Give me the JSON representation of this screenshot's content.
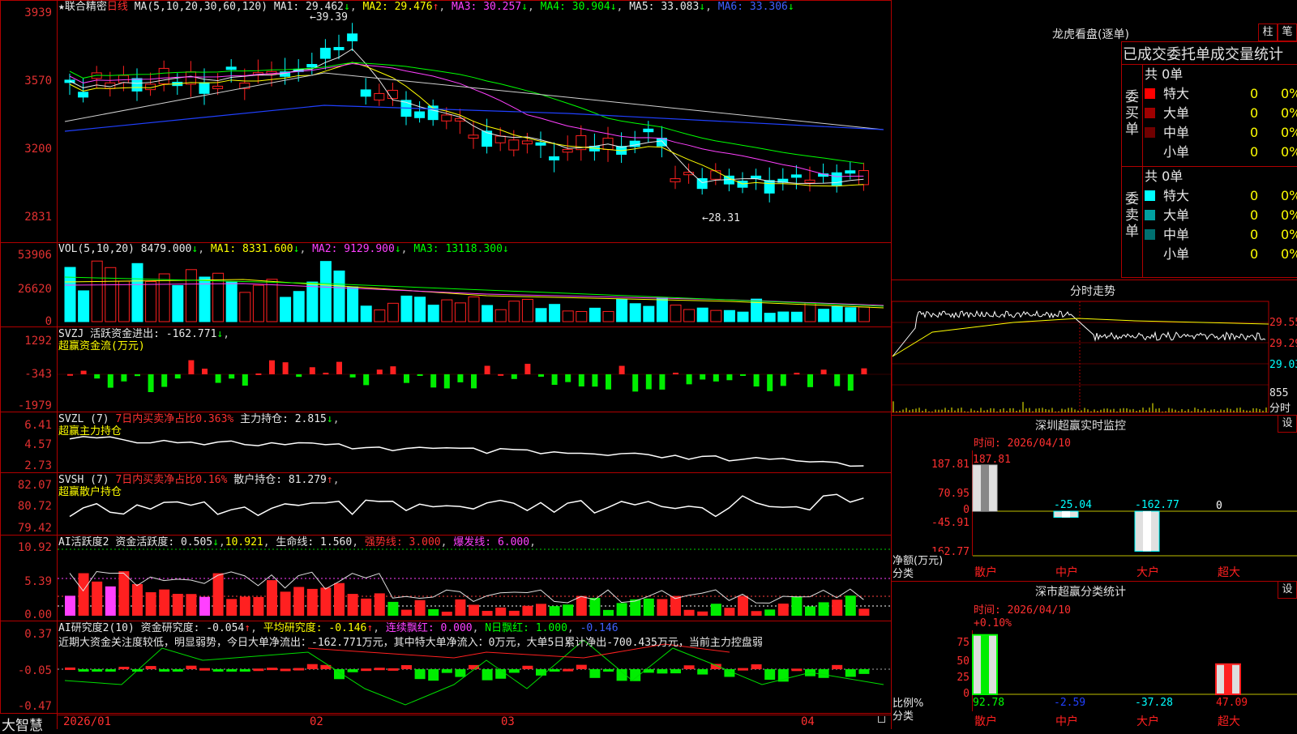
{
  "stock": {
    "name": "联合精密",
    "period": "日线",
    "ma_header": "MA(5,10,20,30,60,120)",
    "ma_values": [
      {
        "label": "MA1: 29.462",
        "arrow": "↓"
      },
      {
        "label": "MA2: 29.476",
        "arrow": "↑"
      },
      {
        "label": "MA3: 30.257",
        "arrow": "↓"
      },
      {
        "label": "MA4: 30.904",
        "arrow": "↓"
      },
      {
        "label": "MA5: 33.083",
        "arrow": "↓"
      },
      {
        "label": "MA6: 33.306",
        "arrow": "↓"
      }
    ],
    "high_mark": "39.39",
    "low_mark": "28.31",
    "price_axis": [
      "3939",
      "3570",
      "3200",
      "2831"
    ]
  },
  "volume": {
    "header": "VOL(5,10,20)",
    "value": "8479.000",
    "ma1": "MA1: 8331.600",
    "ma2": "MA2: 9129.900",
    "ma3": "MA3: 13118.300",
    "axis": [
      "53906",
      "26620",
      "0"
    ]
  },
  "svzj": {
    "header": "SVZJ",
    "label": "活跃资金进出: -162.771",
    "sub": "超赢资金流(万元)",
    "axis": [
      "1292",
      "-343",
      "-1979"
    ]
  },
  "svzl": {
    "header": "SVZL (7)",
    "label1": "7日内买卖净占比0.363%",
    "label2": "主力持仓: 2.815",
    "sub": "超赢主力持仓",
    "axis": [
      "6.41",
      "4.57",
      "2.73"
    ]
  },
  "svsh": {
    "header": "SVSH (7)",
    "label1": "7日内买卖净占比0.16%",
    "label2": "散户持仓: 81.279",
    "sub": "超赢散户持仓",
    "axis": [
      "82.07",
      "80.72",
      "79.42"
    ]
  },
  "ai_active": {
    "header": "AI活跃度2",
    "label1": "资金活跃度: 0.505",
    "label2": "10.921",
    "label3": "生命线: 1.560",
    "label4": "强势线: 3.000",
    "label5": "爆发线: 6.000",
    "axis": [
      "10.92",
      "5.39",
      "0.00"
    ]
  },
  "ai_research": {
    "header": "AI研究度2(10)",
    "label1": "资金研究度: -0.054",
    "label2": "平均研究度: -0.146",
    "label3": "连续飘红: 0.000",
    "label4": "N日飘红: 1.000",
    "label5": "-0.146",
    "comment": "近期大资金关注度较低，明显弱势，今日大单净流出：-162.771万元，其中特大单净流入：0万元，大单5日累计净出-700.435万元，当前主力控盘弱",
    "axis": [
      "0.37",
      "-0.05",
      "-0.47"
    ]
  },
  "bottom": {
    "logo": "大智慧",
    "dates": [
      "2026/01",
      "02",
      "03",
      "04"
    ]
  },
  "longhu": {
    "title": "龙虎看盘(逐单)",
    "btn1": "柱",
    "btn2": "笔",
    "subtitle": "已成交委托单成交量统计",
    "buy_label": "委买单",
    "sell_label": "委卖单",
    "buy_total": "共 0单",
    "sell_total": "共 0单",
    "buy_rows": [
      {
        "name": "特大",
        "count": "0",
        "pct": "0%",
        "color": "#ff0000"
      },
      {
        "name": "大单",
        "count": "0",
        "pct": "0%",
        "color": "#a00000"
      },
      {
        "name": "中单",
        "count": "0",
        "pct": "0%",
        "color": "#700000"
      },
      {
        "name": "小单",
        "count": "0",
        "pct": "0%",
        "color": "#000000"
      }
    ],
    "sell_rows": [
      {
        "name": "特大",
        "count": "0",
        "pct": "0%",
        "color": "#00ffff"
      },
      {
        "name": "大单",
        "count": "0",
        "pct": "0%",
        "color": "#00a0a0"
      },
      {
        "name": "中单",
        "count": "0",
        "pct": "0%",
        "color": "#007070"
      },
      {
        "name": "小单",
        "count": "0",
        "pct": "0%",
        "color": "#000000"
      }
    ]
  },
  "intraday": {
    "title": "分时走势",
    "axis": [
      "29.55",
      "29.29",
      "29.03",
      "855",
      "分时"
    ]
  },
  "sz_monitor": {
    "title": "深圳超赢实时监控",
    "btn": "设",
    "time": "时间: 2026/04/10",
    "axis": [
      "187.81",
      "70.95",
      "0",
      "-45.91",
      "-162.77"
    ],
    "ylabel": "净额(万元)",
    "xlabel": "分类"
  },
  "sz_stats": {
    "title": "深市超赢分类统计",
    "btn": "设",
    "time": "时间: 2026/04/10",
    "top_label": "+0.10%",
    "axis": [
      "75",
      "50",
      "25",
      "0"
    ],
    "ylabel": "比例%",
    "xlabel": "分类"
  },
  "chart_data": [
    {
      "type": "bar",
      "title": "深圳超赢实时监控",
      "categories": [
        "散户",
        "中户",
        "大户",
        "超大"
      ],
      "values": [
        187.81,
        -25.04,
        -162.77,
        0
      ],
      "ylabel": "净额(万元)",
      "xlabel": "分类",
      "ylim": [
        -162.77,
        187.81
      ]
    },
    {
      "type": "bar",
      "title": "深市超赢分类统计",
      "categories": [
        "散户",
        "中户",
        "大户",
        "超大"
      ],
      "values": [
        92.78,
        -2.59,
        -37.28,
        47.09
      ],
      "ylabel": "比例%",
      "xlabel": "分类",
      "ylim": [
        0,
        100
      ]
    },
    {
      "type": "line",
      "title": "分时走势",
      "y_ticks": [
        29.55,
        29.29,
        29.03
      ],
      "volume_tick": 855
    }
  ]
}
